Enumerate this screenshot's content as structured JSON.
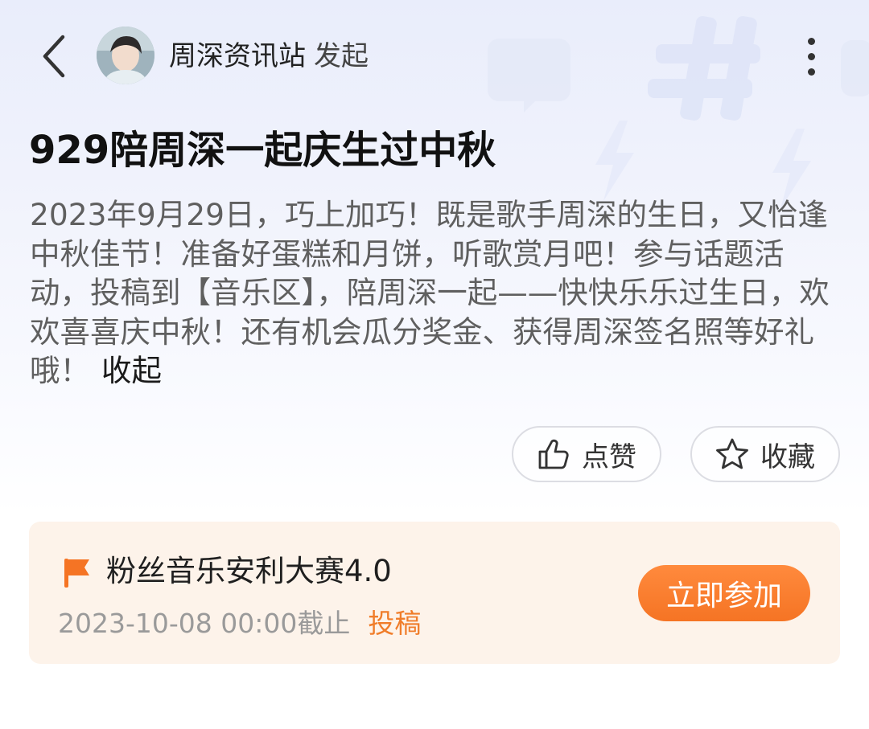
{
  "header": {
    "initiator_name": "周深资讯站",
    "initiator_suffix": "发起"
  },
  "topic": {
    "title": "929陪周深一起庆生过中秋",
    "description": "2023年9月29日，巧上加巧！既是歌手周深的生日，又恰逢中秋佳节！准备好蛋糕和月饼，听歌赏月吧！参与话题活动，投稿到【音乐区】，陪周深一起——快快乐乐过生日，欢欢喜喜庆中秋！还有机会瓜分奖金、获得周深签名照等好礼哦！",
    "collapse_label": "收起"
  },
  "actions": {
    "like_label": "点赞",
    "favorite_label": "收藏"
  },
  "event": {
    "name": "粉丝音乐安利大赛4.0",
    "deadline": "2023-10-08 00:00截止",
    "sub_label": "投稿",
    "join_label": "立即参加"
  },
  "colors": {
    "accent_orange": "#f57424",
    "card_bg": "#fdf3ea",
    "page_bg_top": "#e9edfb"
  },
  "icons": {
    "back": "chevron-left-icon",
    "more": "more-vertical-icon",
    "like": "thumbs-up-icon",
    "favorite": "star-icon",
    "event": "flag-icon"
  }
}
